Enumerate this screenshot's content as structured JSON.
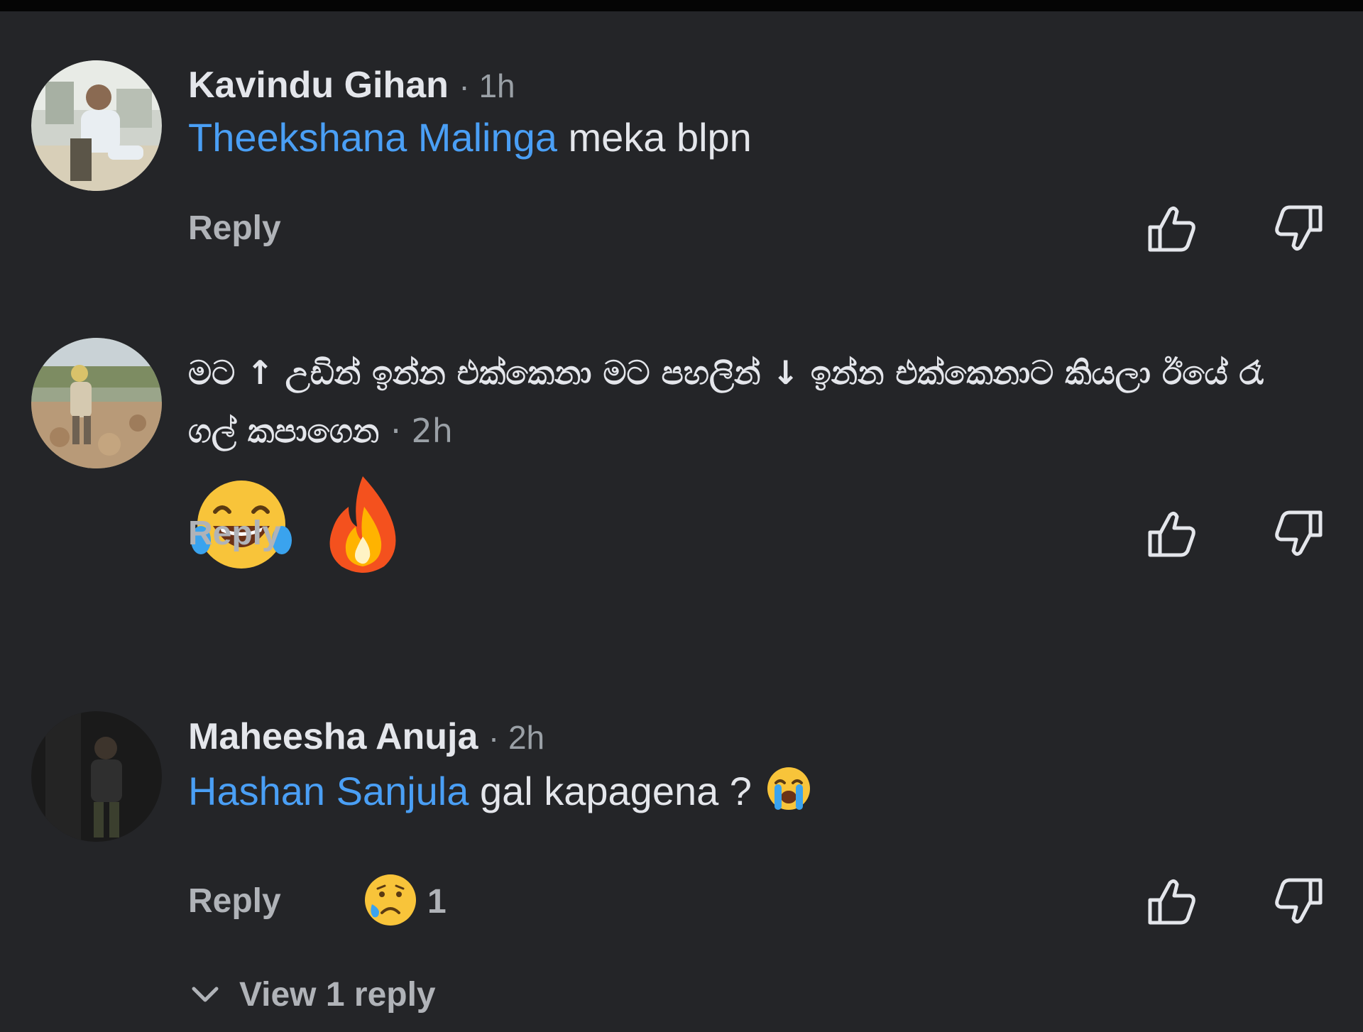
{
  "comments": [
    {
      "author": "Kavindu Gihan",
      "time": "· 1h",
      "mention": "Theekshana Malinga",
      "text": " meka blpn",
      "reply_label": "Reply",
      "avatar_icon": "user-avatar-beach"
    },
    {
      "header_text": "මට ↑ උඩින් ඉන්න එක්කෙනා මට පහලින් ↓ ඉන්න එක්කෙනාට කියලා ඊයේ රෑ",
      "header_text_line2": "ගල් කපාගෙන",
      "time": "· 2h",
      "emojis": [
        "face-with-tears-of-joy-icon",
        "fire-icon"
      ],
      "reply_label": "Reply",
      "avatar_icon": "user-avatar-field"
    },
    {
      "author": "Maheesha Anuja",
      "time": "· 2h",
      "mention": "Hashan Sanjula",
      "text": " gal kapagena ? ",
      "trailing_emoji": "loudly-crying-face-icon",
      "reply_label": "Reply",
      "reaction_emoji": "sad-but-relieved-face-icon",
      "reaction_count": "1",
      "avatar_icon": "user-avatar-dark"
    }
  ],
  "view_replies": {
    "label": "View 1 reply",
    "icon": "chevron-down-icon"
  },
  "colors": {
    "background": "#242528",
    "mention": "#4a9ff5",
    "text": "#e4e6eb",
    "muted": "#b0b3b8"
  }
}
